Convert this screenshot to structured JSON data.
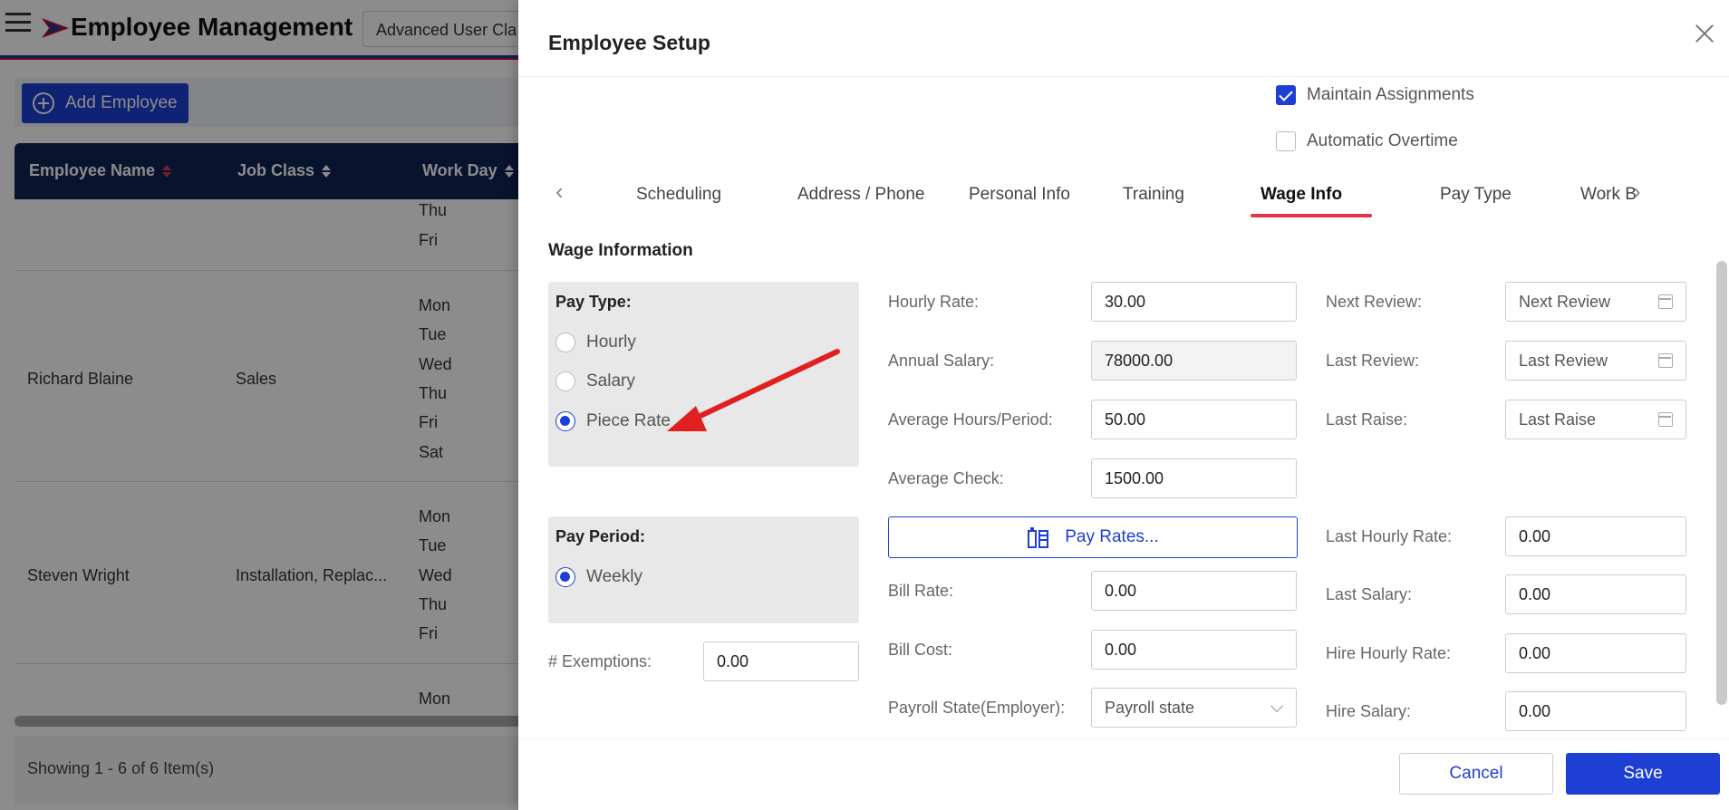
{
  "app": {
    "title": "Employee Management",
    "role_select": "Advanced User Cla"
  },
  "toolbar": {
    "add_employee_label": "Add Employee"
  },
  "grid": {
    "columns": [
      "Employee Name",
      "Job Class",
      "Work Day"
    ],
    "rows": [
      {
        "name": "",
        "job_class": "",
        "days": [
          "Thu",
          "Fri"
        ]
      },
      {
        "name": "Richard Blaine",
        "job_class": "Sales",
        "days": [
          "Mon",
          "Tue",
          "Wed",
          "Thu",
          "Fri",
          "Sat"
        ]
      },
      {
        "name": "Steven Wright",
        "job_class": "Installation, Replac...",
        "days": [
          "Mon",
          "Tue",
          "Wed",
          "Thu",
          "Fri"
        ]
      },
      {
        "name": "",
        "job_class": "",
        "days": [
          "Mon"
        ]
      }
    ],
    "footer": "Showing 1 - 6 of 6 Item(s)"
  },
  "drawer": {
    "title": "Employee Setup",
    "maintain_assignments": {
      "label": "Maintain Assignments",
      "checked": true
    },
    "automatic_overtime": {
      "label": "Automatic Overtime",
      "checked": false
    },
    "tabs": [
      "Scheduling",
      "Address / Phone",
      "Personal Info",
      "Training",
      "Wage Info",
      "Pay Type",
      "Work B"
    ],
    "active_tab": "Wage Info",
    "section_title": "Wage Information",
    "pay_type": {
      "title": "Pay Type:",
      "options": [
        "Hourly",
        "Salary",
        "Piece Rate"
      ],
      "selected": "Piece Rate"
    },
    "pay_period": {
      "title": "Pay Period:",
      "options": [
        "Weekly"
      ],
      "selected": "Weekly"
    },
    "exemptions": {
      "label": "# Exemptions:",
      "value": "0.00"
    },
    "fields_mid": {
      "hourly_rate": {
        "label": "Hourly Rate:",
        "value": "30.00"
      },
      "annual_salary": {
        "label": "Annual Salary:",
        "value": "78000.00"
      },
      "avg_hours": {
        "label": "Average Hours/Period:",
        "value": "50.00"
      },
      "avg_check": {
        "label": "Average Check:",
        "value": "1500.00"
      },
      "pay_rates_button": "Pay Rates...",
      "bill_rate": {
        "label": "Bill Rate:",
        "value": "0.00"
      },
      "bill_cost": {
        "label": "Bill Cost:",
        "value": "0.00"
      },
      "payroll_state": {
        "label": "Payroll State(Employer):",
        "placeholder": "Payroll state"
      }
    },
    "fields_right": {
      "next_review": {
        "label": "Next Review:",
        "placeholder": "Next Review"
      },
      "last_review": {
        "label": "Last Review:",
        "placeholder": "Last Review"
      },
      "last_raise": {
        "label": "Last Raise:",
        "placeholder": "Last Raise"
      },
      "last_hourly_rate": {
        "label": "Last Hourly Rate:",
        "value": "0.00"
      },
      "last_salary": {
        "label": "Last Salary:",
        "value": "0.00"
      },
      "hire_hourly_rate": {
        "label": "Hire Hourly Rate:",
        "value": "0.00"
      },
      "hire_salary": {
        "label": "Hire Salary:",
        "value": "0.00"
      }
    },
    "footer": {
      "cancel_label": "Cancel",
      "save_label": "Save"
    }
  },
  "colors": {
    "primary": "#1d3fd4",
    "grid_header": "#0f2454",
    "accent_red": "#e0344b",
    "annotation_arrow": "#e02020"
  },
  "icons": [
    "hamburger-icon",
    "logo-icon",
    "plus-circle-icon",
    "sort-icon",
    "close-icon",
    "chevron-left-icon",
    "chevron-right-icon",
    "calendar-icon",
    "chevron-down-icon",
    "pay-rates-icon",
    "annotation-arrow"
  ]
}
